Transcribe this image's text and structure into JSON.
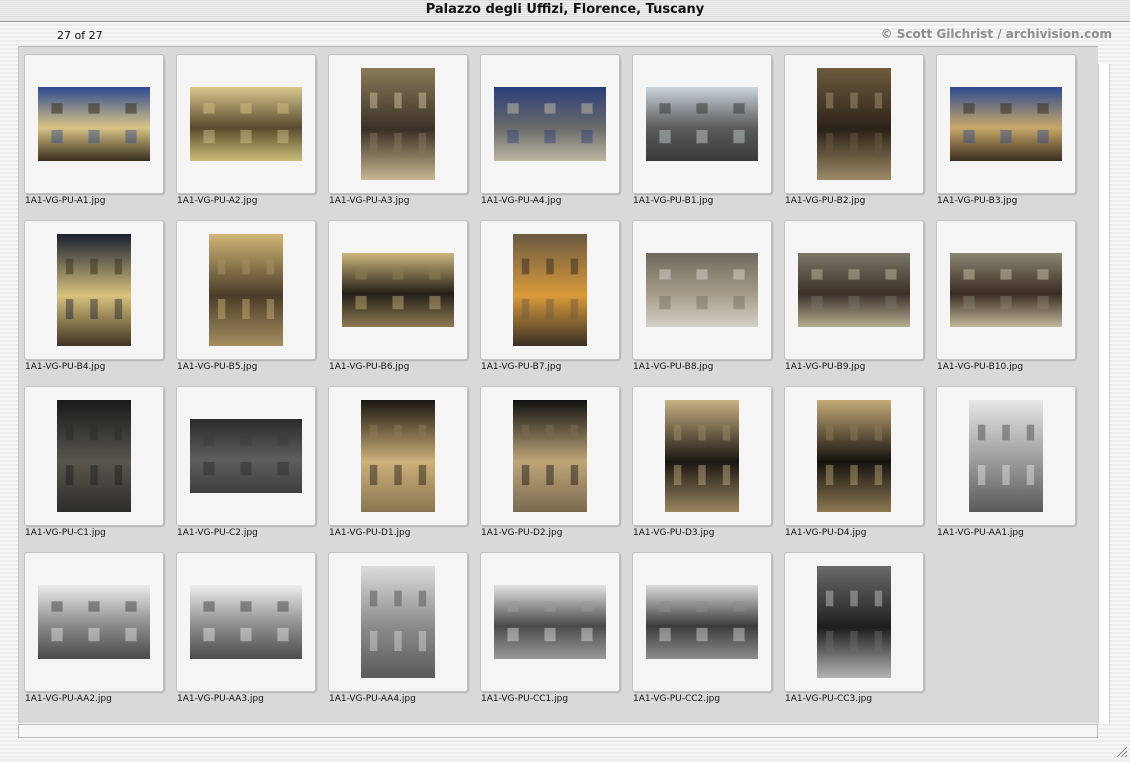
{
  "window": {
    "title": "Palazzo degli Uffizi, Florence, Tuscany"
  },
  "header": {
    "counter": "27 of 27",
    "credit": "© Scott Gilchrist / archivision.com"
  },
  "thumbnails": [
    {
      "filename": "1A1-VG-PU-A1.jpg",
      "orientation": "landscape",
      "palette": [
        "#2c4b8f",
        "#d9c486",
        "#3a2e1f"
      ]
    },
    {
      "filename": "1A1-VG-PU-A2.jpg",
      "orientation": "landscape",
      "palette": [
        "#d8c68e",
        "#5a4a2c",
        "#cbbd7a"
      ]
    },
    {
      "filename": "1A1-VG-PU-A3.jpg",
      "orientation": "portrait",
      "palette": [
        "#8a7a5a",
        "#3a3026",
        "#c9b892"
      ]
    },
    {
      "filename": "1A1-VG-PU-A4.jpg",
      "orientation": "landscape",
      "palette": [
        "#2b3e7a",
        "#6a6a6a",
        "#bdb7a4"
      ]
    },
    {
      "filename": "1A1-VG-PU-B1.jpg",
      "orientation": "landscape",
      "palette": [
        "#c9d4dc",
        "#5b5b5b",
        "#3a3a3a"
      ]
    },
    {
      "filename": "1A1-VG-PU-B2.jpg",
      "orientation": "portrait",
      "palette": [
        "#6d5a3e",
        "#2b2218",
        "#9e8a66"
      ]
    },
    {
      "filename": "1A1-VG-PU-B3.jpg",
      "orientation": "landscape",
      "palette": [
        "#2c4b8f",
        "#c9a86a",
        "#3a2e1f"
      ]
    },
    {
      "filename": "1A1-VG-PU-B4.jpg",
      "orientation": "portrait",
      "palette": [
        "#1b2030",
        "#d8c27e",
        "#403424"
      ]
    },
    {
      "filename": "1A1-VG-PU-B5.jpg",
      "orientation": "portrait",
      "palette": [
        "#d1b677",
        "#4a3c28",
        "#a58f60"
      ]
    },
    {
      "filename": "1A1-VG-PU-B6.jpg",
      "orientation": "landscape",
      "palette": [
        "#cdb67c",
        "#242018",
        "#8d7a52"
      ]
    },
    {
      "filename": "1A1-VG-PU-B7.jpg",
      "orientation": "portrait",
      "palette": [
        "#6c5a42",
        "#d99a3a",
        "#3a3026"
      ]
    },
    {
      "filename": "1A1-VG-PU-B8.jpg",
      "orientation": "landscape",
      "palette": [
        "#6f6a5e",
        "#a49c88",
        "#d4d0c6"
      ]
    },
    {
      "filename": "1A1-VG-PU-B9.jpg",
      "orientation": "landscape",
      "palette": [
        "#7b7868",
        "#3b3128",
        "#b6ae92"
      ]
    },
    {
      "filename": "1A1-VG-PU-B10.jpg",
      "orientation": "landscape",
      "palette": [
        "#8a8672",
        "#3a2c22",
        "#c0b89c"
      ]
    },
    {
      "filename": "1A1-VG-PU-C1.jpg",
      "orientation": "portrait",
      "palette": [
        "#1a1a1a",
        "#5a564e",
        "#2e2c28"
      ]
    },
    {
      "filename": "1A1-VG-PU-C2.jpg",
      "orientation": "landscape",
      "palette": [
        "#2a2a2a",
        "#5e5e5e",
        "#3e3e3e"
      ]
    },
    {
      "filename": "1A1-VG-PU-D1.jpg",
      "orientation": "portrait",
      "palette": [
        "#1a1612",
        "#cdb07a",
        "#8a7652"
      ]
    },
    {
      "filename": "1A1-VG-PU-D2.jpg",
      "orientation": "portrait",
      "palette": [
        "#121212",
        "#bfa678",
        "#7a6a50"
      ]
    },
    {
      "filename": "1A1-VG-PU-D3.jpg",
      "orientation": "portrait",
      "palette": [
        "#c8b184",
        "#1a1612",
        "#9a8660"
      ]
    },
    {
      "filename": "1A1-VG-PU-D4.jpg",
      "orientation": "portrait",
      "palette": [
        "#c4ab78",
        "#15120e",
        "#8c7852"
      ]
    },
    {
      "filename": "1A1-VG-PU-AA1.jpg",
      "orientation": "portrait",
      "palette": [
        "#e6e6e6",
        "#9a9a9a",
        "#5a5a5a"
      ]
    },
    {
      "filename": "1A1-VG-PU-AA2.jpg",
      "orientation": "landscape",
      "palette": [
        "#ececec",
        "#8a8a8a",
        "#4a4a4a"
      ]
    },
    {
      "filename": "1A1-VG-PU-AA3.jpg",
      "orientation": "landscape",
      "palette": [
        "#ededed",
        "#8c8c8c",
        "#4c4c4c"
      ]
    },
    {
      "filename": "1A1-VG-PU-AA4.jpg",
      "orientation": "portrait",
      "palette": [
        "#dcdcdc",
        "#8a8a8a",
        "#5a5a5a"
      ]
    },
    {
      "filename": "1A1-VG-PU-CC1.jpg",
      "orientation": "landscape",
      "palette": [
        "#e4e4e4",
        "#4a4a4a",
        "#9a9a9a"
      ]
    },
    {
      "filename": "1A1-VG-PU-CC2.jpg",
      "orientation": "landscape",
      "palette": [
        "#dcdcdc",
        "#3c3c3c",
        "#8c8c8c"
      ]
    },
    {
      "filename": "1A1-VG-PU-CC3.jpg",
      "orientation": "portrait",
      "palette": [
        "#6a6a6a",
        "#1e1e1e",
        "#b4b4b4"
      ]
    }
  ]
}
